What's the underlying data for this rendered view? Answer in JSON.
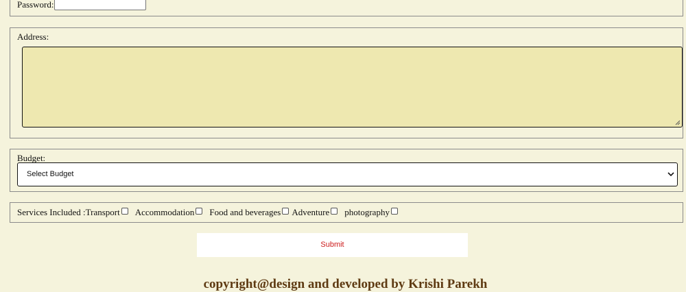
{
  "form": {
    "password": {
      "label": "Password:",
      "value": ""
    },
    "address": {
      "label": "Address:",
      "value": ""
    },
    "budget": {
      "label": "Budget:",
      "selected": "Select Budget"
    },
    "services": {
      "label": "Services Included : ",
      "options": [
        {
          "label": "Transport",
          "checked": false
        },
        {
          "label": "Accommodation",
          "checked": false
        },
        {
          "label": "Food and beverages",
          "checked": false
        },
        {
          "label": "Adventure",
          "checked": false
        },
        {
          "label": "photography",
          "checked": false
        }
      ]
    },
    "submit_label": "Submit"
  },
  "footer": {
    "text": "copyright@design and developed by Krishi Parekh"
  },
  "colors": {
    "page_background": "#f5f3dc",
    "textarea_background": "#eee8b0",
    "submit_text": "#cc1a1a",
    "footer_text": "#5e3a12"
  },
  "icons": {
    "select_arrow": "chevron-down-icon",
    "textarea_resize": "resize-grip-icon"
  }
}
